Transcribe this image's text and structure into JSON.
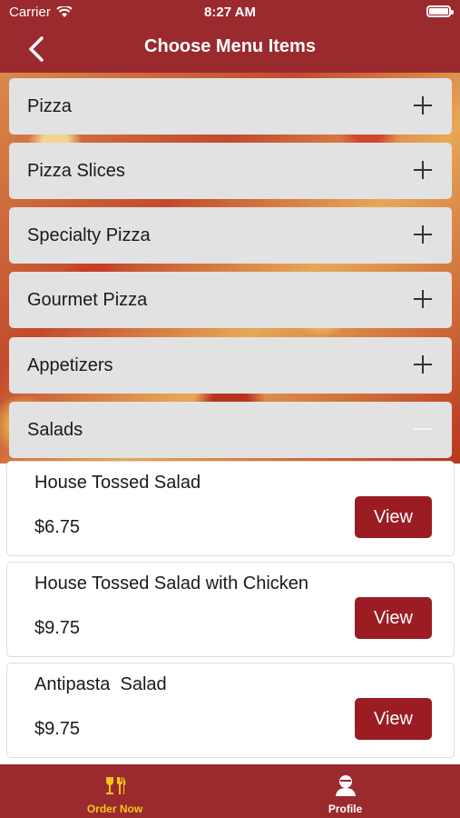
{
  "status_bar": {
    "carrier": "Carrier",
    "time": "8:27 AM"
  },
  "nav": {
    "title": "Choose Menu Items"
  },
  "categories": [
    {
      "label": "Pizza",
      "expanded": false
    },
    {
      "label": "Pizza Slices",
      "expanded": false
    },
    {
      "label": "Specialty Pizza",
      "expanded": false
    },
    {
      "label": "Gourmet Pizza",
      "expanded": false
    },
    {
      "label": "Appetizers",
      "expanded": false
    },
    {
      "label": "Salads",
      "expanded": true
    }
  ],
  "items": [
    {
      "name": "House Tossed Salad",
      "price": "$6.75",
      "button": "View"
    },
    {
      "name": "House Tossed Salad with Chicken",
      "price": "$9.75",
      "button": "View"
    },
    {
      "name": "Antipasta  Salad",
      "price": "$9.75",
      "button": "View"
    }
  ],
  "tabs": [
    {
      "label": "Order Now",
      "icon": "order-now-icon",
      "active": true
    },
    {
      "label": "Profile",
      "icon": "profile-icon",
      "active": false
    }
  ],
  "colors": {
    "brand": "#9b2a2f",
    "button": "#9b1c22",
    "active_tab": "#f5c518",
    "inactive_tab": "#ffffff"
  }
}
